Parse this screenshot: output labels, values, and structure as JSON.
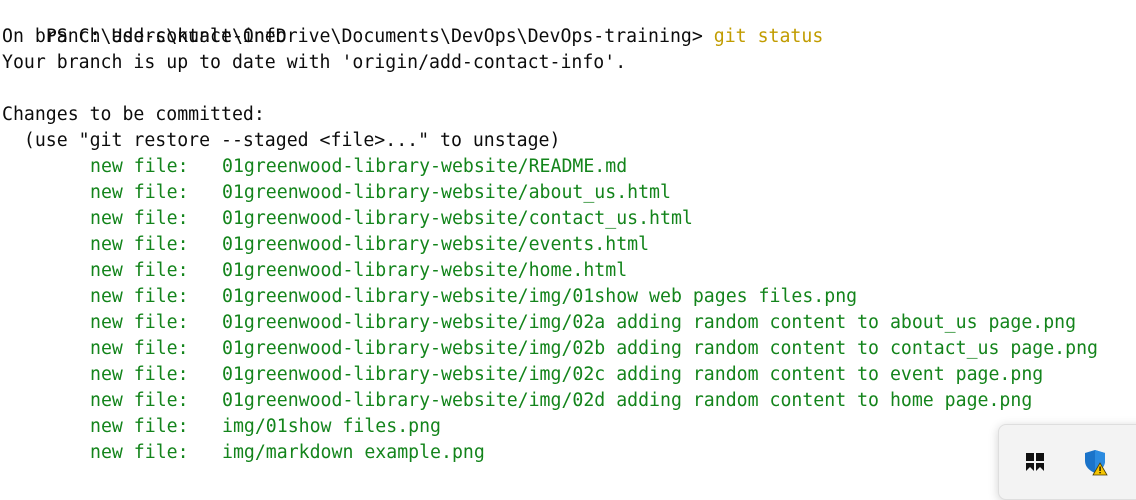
{
  "prompt": {
    "path": "PS C:\\Users\\kunle\\OneDrive\\Documents\\DevOps\\DevOps-training>",
    "command": "git status"
  },
  "output": {
    "branch_line": "On branch add-contact-info",
    "upstream_line": "Your branch is up to date with 'origin/add-contact-info'.",
    "section_header": "Changes to be committed:",
    "hint": "  (use \"git restore --staged <file>...\" to unstage)",
    "files": [
      {
        "status": "new file:",
        "path": "01greenwood-library-website/README.md"
      },
      {
        "status": "new file:",
        "path": "01greenwood-library-website/about_us.html"
      },
      {
        "status": "new file:",
        "path": "01greenwood-library-website/contact_us.html"
      },
      {
        "status": "new file:",
        "path": "01greenwood-library-website/events.html"
      },
      {
        "status": "new file:",
        "path": "01greenwood-library-website/home.html"
      },
      {
        "status": "new file:",
        "path": "01greenwood-library-website/img/01show web pages files.png"
      },
      {
        "status": "new file:",
        "path": "01greenwood-library-website/img/02a adding random content to about_us page.png"
      },
      {
        "status": "new file:",
        "path": "01greenwood-library-website/img/02b adding random content to contact_us page.png"
      },
      {
        "status": "new file:",
        "path": "01greenwood-library-website/img/02c adding random content to event page.png"
      },
      {
        "status": "new file:",
        "path": "01greenwood-library-website/img/02d adding random content to home page.png"
      },
      {
        "status": "new file:",
        "path": "img/01show files.png"
      },
      {
        "status": "new file:",
        "path": "img/markdown example.png"
      }
    ]
  },
  "tray": {
    "icons": [
      "app-tile-icon",
      "defender-shield-warning-icon"
    ]
  },
  "colors": {
    "background": "#ffffff",
    "text": "#0c0c0c",
    "command": "#c19c00",
    "staged_file": "#13841b"
  }
}
